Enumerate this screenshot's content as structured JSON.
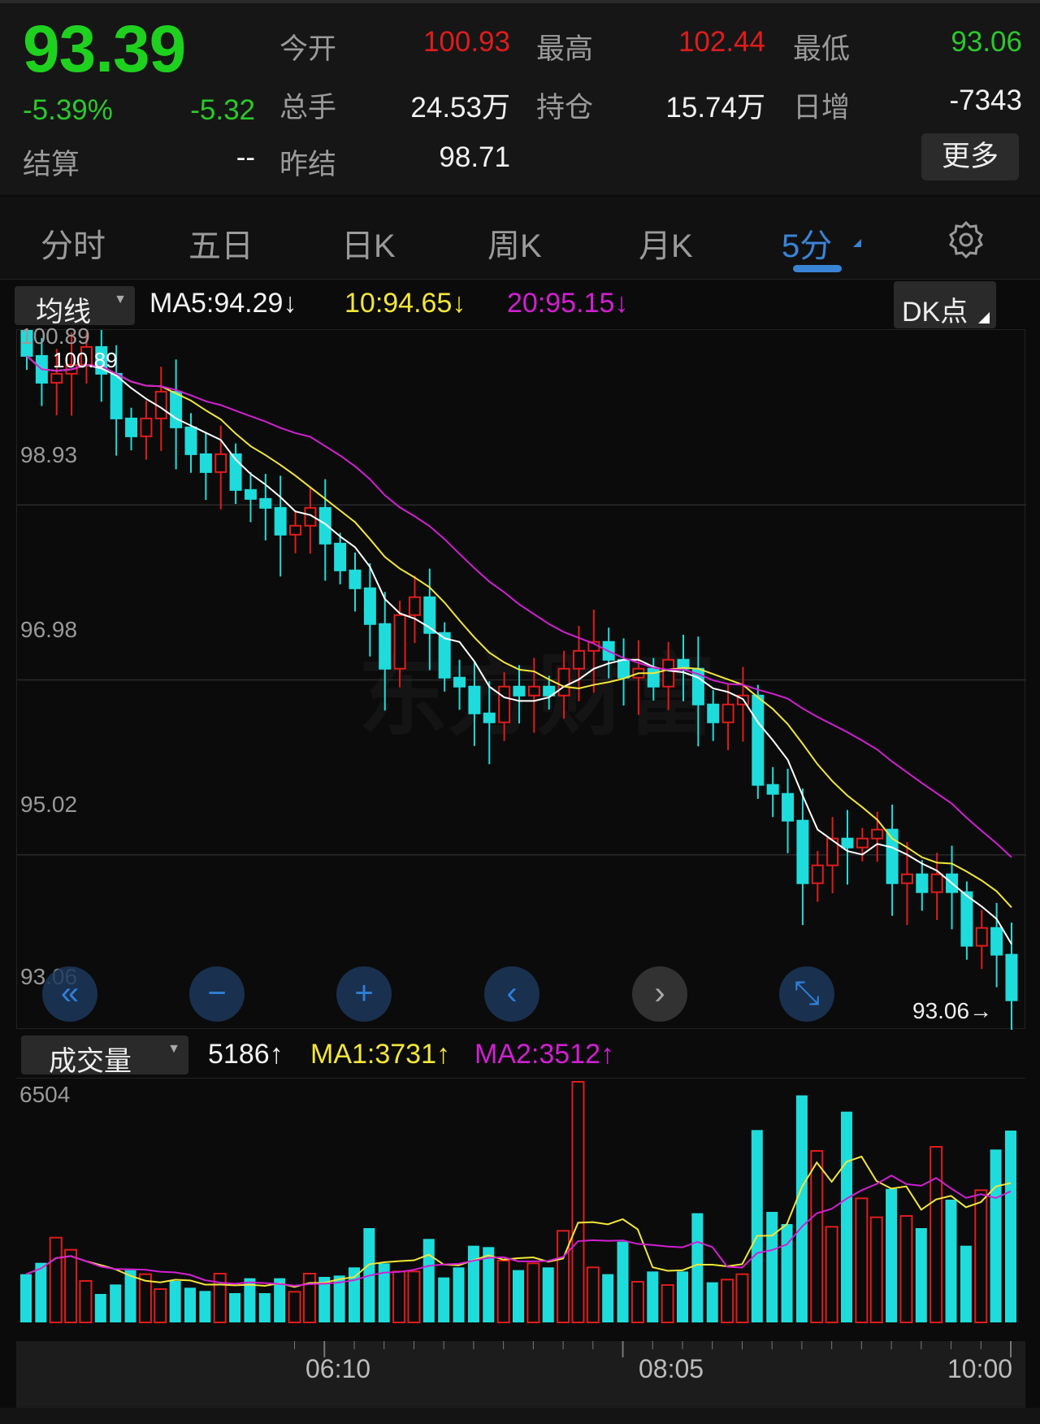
{
  "quote": {
    "price": "93.39",
    "change_pct": "-5.39%",
    "change": "-5.32",
    "fields": [
      {
        "label": "今开",
        "value": "100.93",
        "color": "r"
      },
      {
        "label": "最高",
        "value": "102.44",
        "color": "r"
      },
      {
        "label": "最低",
        "value": "93.06",
        "color": "g"
      },
      {
        "label": "总手",
        "value": "24.53万",
        "color": "w"
      },
      {
        "label": "持仓",
        "value": "15.74万",
        "color": "w"
      },
      {
        "label": "日增",
        "value": "-7343",
        "color": "w"
      },
      {
        "label": "结算",
        "value": "--",
        "color": "w"
      },
      {
        "label": "昨结",
        "value": "98.71",
        "color": "w"
      }
    ],
    "more_label": "更多"
  },
  "tabs": [
    {
      "label": "分时"
    },
    {
      "label": "五日"
    },
    {
      "label": "日K"
    },
    {
      "label": "周K"
    },
    {
      "label": "月K"
    },
    {
      "label": "5分",
      "active": true
    }
  ],
  "settings_icon": "gear-icon",
  "indicator": {
    "selector": "均线",
    "ma5": "MA5:94.29↓",
    "ma10": "10:94.65↓",
    "ma20": "20:95.15↓",
    "dk_label": "DK点"
  },
  "price_axis": {
    "labels": [
      "100.89",
      "98.93",
      "96.98",
      "95.02",
      "93.06"
    ],
    "top_label": "100.89",
    "last_price_tag": "93.06→"
  },
  "watermark": "东方财富",
  "nav_buttons": [
    {
      "icon": "double-left-icon",
      "glyph": "«"
    },
    {
      "icon": "zoom-out-icon",
      "glyph": "−"
    },
    {
      "icon": "zoom-in-icon",
      "glyph": "+"
    },
    {
      "icon": "chevron-left-icon",
      "glyph": "‹"
    },
    {
      "icon": "chevron-right-icon",
      "glyph": "›"
    },
    {
      "icon": "fullscreen-icon",
      "glyph": "⤡"
    }
  ],
  "volume_header": {
    "selector": "成交量",
    "value": "5186↑",
    "ma1": "MA1:3731↑",
    "ma2": "MA2:3512↑"
  },
  "time_axis": [
    "06:10",
    "08:05",
    "10:00"
  ],
  "colors": {
    "up": "#e01c1c",
    "down": "#1fdcdc",
    "ma5": "#ffffff",
    "ma10": "#f2e63a",
    "ma20": "#d21fd2",
    "accent": "#3a84d6"
  },
  "chart_data": {
    "type": "candlestick",
    "ylim": [
      93.06,
      100.89
    ],
    "first_open": 100.9,
    "last_low": 93.06,
    "closes": [
      100.6,
      100.3,
      100.4,
      100.5,
      100.7,
      100.4,
      99.9,
      99.7,
      99.9,
      100.2,
      99.8,
      99.5,
      99.3,
      99.5,
      99.1,
      99.0,
      98.9,
      98.6,
      98.7,
      98.9,
      98.5,
      98.2,
      98.0,
      97.6,
      97.1,
      97.7,
      97.9,
      97.5,
      97.0,
      96.9,
      96.6,
      96.5,
      96.9,
      96.8,
      96.9,
      96.8,
      97.1,
      97.3,
      97.4,
      97.2,
      97.0,
      97.1,
      96.9,
      97.2,
      97.1,
      96.7,
      96.5,
      96.7,
      96.8,
      95.8,
      95.7,
      95.4,
      94.7,
      94.9,
      95.2,
      95.1,
      95.2,
      95.3,
      94.7,
      94.8,
      94.6,
      94.8,
      94.6,
      94.0,
      94.2,
      93.9,
      93.39
    ],
    "volume_max": 6504,
    "volumes": [
      1304,
      1611,
      2292,
      1963,
      1121,
      769,
      1025,
      1414,
      1304,
      901,
      1121,
      937,
      850,
      1318,
      791,
      1194,
      791,
      1194,
      828,
      1318,
      1230,
      1267,
      1487,
      2549,
      1597,
      1377,
      1377,
      2256,
      1216,
      1487,
      2073,
      2036,
      1670,
      1414,
      1597,
      1487,
      2476,
      6504,
      1487,
      1304,
      2183,
      1099,
      1377,
      1011,
      1377,
      2952,
      1084,
      1157,
      1304,
      5200,
      2988,
      2659,
      6138,
      4636,
      2585,
      5698,
      3354,
      2842,
      3611,
      2878,
      2549,
      4746,
      3318,
      2073,
      3574,
      4673,
      5186
    ]
  }
}
